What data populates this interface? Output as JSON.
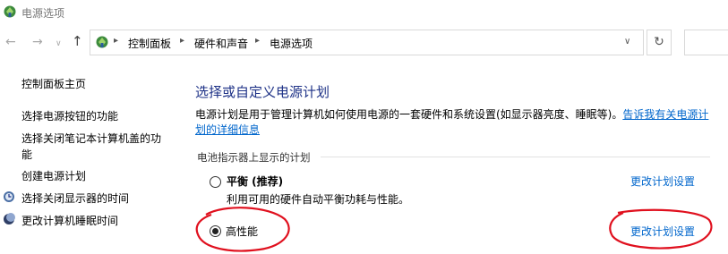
{
  "window": {
    "title": "电源选项"
  },
  "address_bar": {
    "breadcrumb": [
      "控制面板",
      "硬件和声音",
      "电源选项"
    ]
  },
  "left_nav": {
    "items": [
      {
        "label": "控制面板主页"
      },
      {
        "label": "选择电源按钮的功能"
      },
      {
        "label": "选择关闭笔记本计算机盖的功"
      },
      {
        "label": "能"
      },
      {
        "label": "创建电源计划"
      },
      {
        "label": "选择关闭显示器的时间",
        "icon": "moon-clock-icon"
      },
      {
        "label": "更改计算机睡眠时间",
        "icon": "moon-icon"
      }
    ]
  },
  "main": {
    "title": "选择或自定义电源计划",
    "description": "电源计划是用于管理计算机如何使用电源的一套硬件和系统设置(如显示器亮度、睡眠等)。",
    "description_link": "告诉我有关电源计划的详细信息",
    "section_label": "电池指示器上显示的计划",
    "plans": [
      {
        "name": "平衡 (推荐)",
        "description": "利用可用的硬件自动平衡功耗与性能。",
        "selected": false,
        "change_link": "更改计划设置"
      },
      {
        "name": "高性能",
        "selected": true,
        "change_link": "更改计划设置"
      }
    ]
  },
  "colors": {
    "title_blue": "#1e3287",
    "link_blue": "#0066cc",
    "annotation_red": "#e0101e"
  }
}
